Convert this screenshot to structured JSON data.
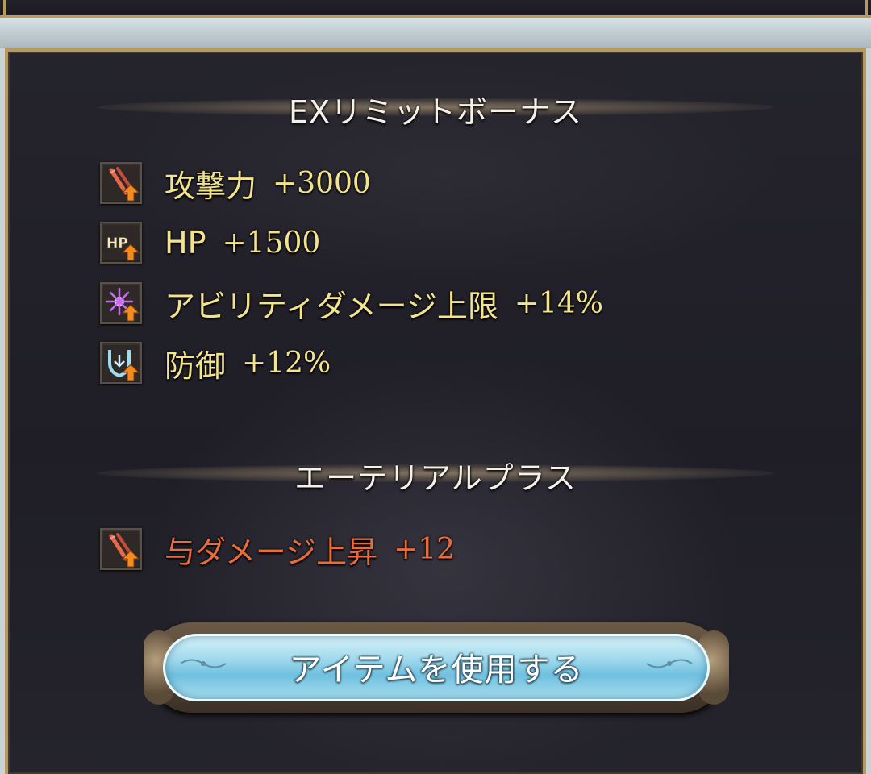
{
  "ex_limit": {
    "title": "EXリミットボーナス",
    "rows": [
      {
        "icon": "attack-up-icon",
        "label": "攻撃力",
        "value": "+3000"
      },
      {
        "icon": "hp-up-icon",
        "label": "HP",
        "value": "+1500"
      },
      {
        "icon": "ability-damage-cap-up-icon",
        "label": "アビリティダメージ上限",
        "value": "+14%"
      },
      {
        "icon": "defense-up-icon",
        "label": "防御",
        "value": "+12%"
      }
    ]
  },
  "ethereal_plus": {
    "title": "エーテリアルプラス",
    "rows": [
      {
        "icon": "damage-dealt-up-icon",
        "label": "与ダメージ上昇",
        "value": "+12"
      }
    ]
  },
  "use_item_button": {
    "label": "アイテムを使用する"
  },
  "colors": {
    "frame_gold": "#b99a5d",
    "text_yellow": "#f3e48c",
    "text_orange": "#e86b38",
    "button_blue": "#9ed8ec"
  }
}
